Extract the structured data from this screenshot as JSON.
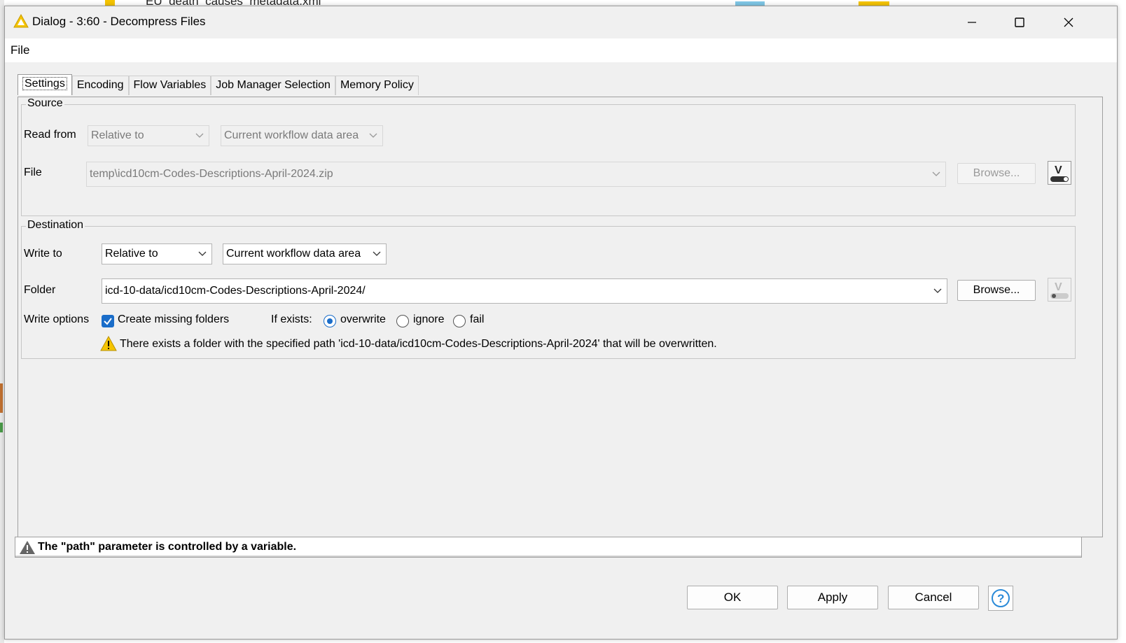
{
  "window": {
    "title": "Dialog - 3:60 - Decompress Files",
    "background_text": "EU_death_causes_metadata.xml"
  },
  "menu": {
    "file": "File"
  },
  "tabs": [
    {
      "label": "Settings",
      "active": true
    },
    {
      "label": "Encoding",
      "active": false
    },
    {
      "label": "Flow Variables",
      "active": false
    },
    {
      "label": "Job Manager Selection",
      "active": false
    },
    {
      "label": "Memory Policy",
      "active": false
    }
  ],
  "source": {
    "title": "Source",
    "read_from_label": "Read from",
    "read_from_mode": "Relative to",
    "read_from_location": "Current workflow data area",
    "file_label": "File",
    "file_value": "temp\\icd10cm-Codes-Descriptions-April-2024.zip",
    "browse_label": "Browse..."
  },
  "destination": {
    "title": "Destination",
    "write_to_label": "Write to",
    "write_to_mode": "Relative to",
    "write_to_location": "Current workflow data area",
    "folder_label": "Folder",
    "folder_value": "icd-10-data/icd10cm-Codes-Descriptions-April-2024/",
    "browse_label": "Browse...",
    "write_options_label": "Write options",
    "create_missing_label": "Create missing folders",
    "if_exists_label": "If exists:",
    "option_overwrite": "overwrite",
    "option_ignore": "ignore",
    "option_fail": "fail",
    "warning_text": "There exists a folder with the specified path 'icd-10-data/icd10cm-Codes-Descriptions-April-2024' that will be overwritten."
  },
  "status": {
    "message": "The \"path\" parameter is controlled by a variable."
  },
  "footer": {
    "ok": "OK",
    "apply": "Apply",
    "cancel": "Cancel"
  },
  "colors": {
    "accent": "#1a6dc9",
    "warning": "#f5c400"
  }
}
